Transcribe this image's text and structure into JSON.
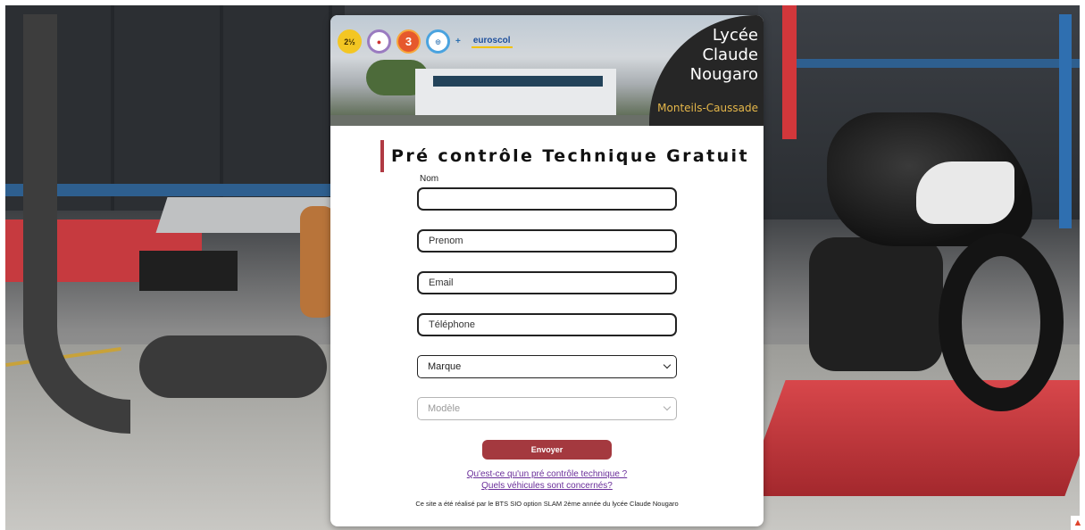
{
  "banner": {
    "school_name_line1": "Lycée",
    "school_name_line2": "Claude",
    "school_name_line3": "Nougaro",
    "school_city": "Monteils-Caussade",
    "logos": [
      {
        "name": "anniversary-badge-icon",
        "text": "2½"
      },
      {
        "name": "label-badge-icon",
        "text": "🇫🇷"
      },
      {
        "name": "lycee-3-badge-icon",
        "text": "3"
      },
      {
        "name": "eco-badge-icon",
        "text": "◎"
      }
    ],
    "euroscol": "euroscol"
  },
  "form": {
    "title": "Pré contrôle Technique Gratuit",
    "nom_label": "Nom",
    "nom_value": "",
    "prenom_placeholder": "Prenom",
    "email_placeholder": "Email",
    "telephone_placeholder": "Téléphone",
    "marque_selected": "Marque",
    "modele_selected": "Modèle",
    "submit_label": "Envoyer"
  },
  "links": {
    "what_is": "Qu'est-ce qu'un pré contrôle technique ?",
    "which_vehicles": "Quels véhicules sont concernés?"
  },
  "footer": {
    "credit": "Ce site a été réalisé par le BTS SIO option SLAM 2ème année du lycée Claude Nougaro"
  },
  "colors": {
    "accent": "#a4393f",
    "link": "#6a2e9a",
    "city": "#e5b74a"
  }
}
